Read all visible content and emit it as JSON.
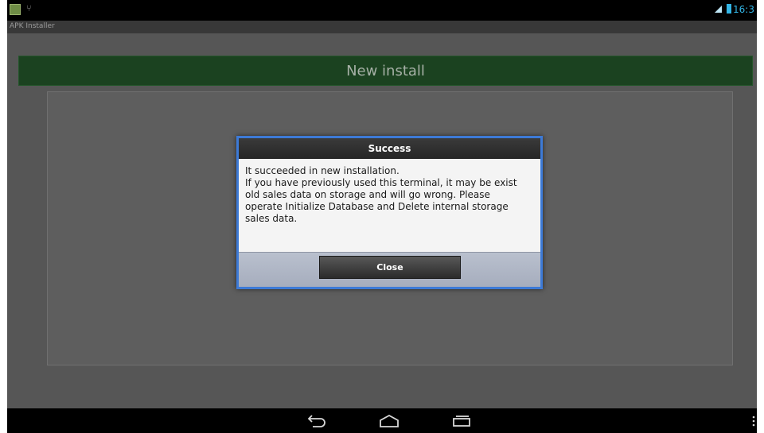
{
  "status_bar": {
    "time": "16:3",
    "icons": [
      "app-icon",
      "usb-icon",
      "signal-icon",
      "battery-icon"
    ]
  },
  "title_bar": {
    "title": "APK Installer"
  },
  "header": {
    "title": "New install"
  },
  "dialog": {
    "title": "Success",
    "message_lines": [
      "It succeeded in new installation.",
      "If you have previously used this terminal, it may be exist",
      "old sales data on storage and will go wrong. Please",
      "operate Initialize Database and Delete internal storage",
      "sales data."
    ],
    "button_label": "Close"
  },
  "nav_bar": {
    "icons": [
      "back-icon",
      "home-icon",
      "recents-icon",
      "menu-icon"
    ]
  },
  "colors": {
    "dialog_border": "#3d7ad6",
    "header_green": "#1b4220",
    "status_accent": "#33b5e5"
  }
}
